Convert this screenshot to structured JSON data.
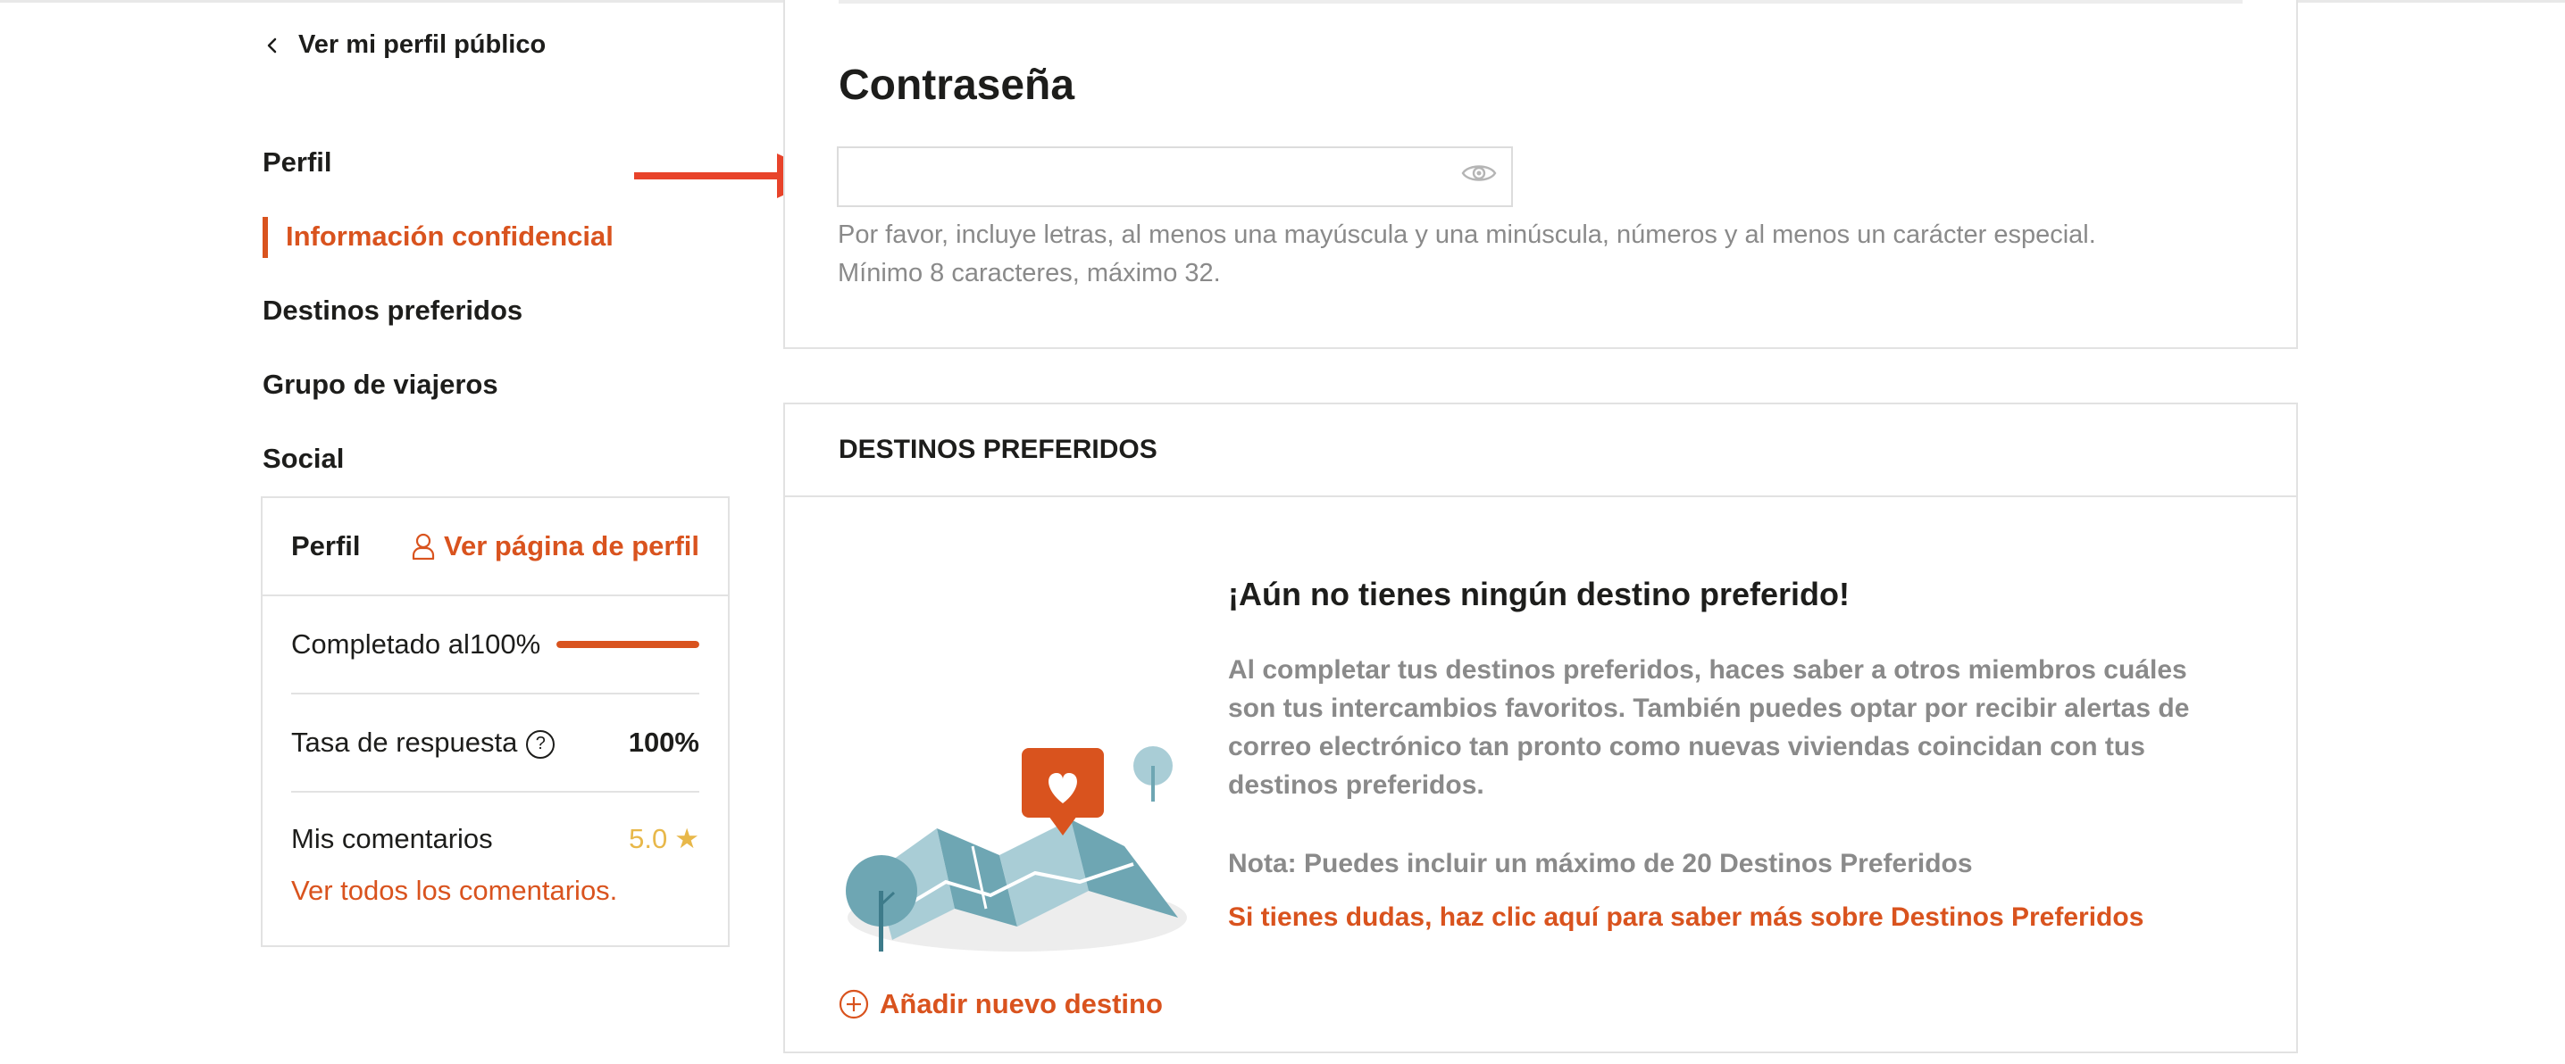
{
  "sidebar": {
    "back_link": "Ver mi perfil público",
    "items": [
      {
        "label": "Perfil",
        "active": false
      },
      {
        "label": "Información confidencial",
        "active": true
      },
      {
        "label": "Destinos preferidos",
        "active": false
      },
      {
        "label": "Grupo de viajeros",
        "active": false
      },
      {
        "label": "Social",
        "active": false
      }
    ]
  },
  "profile_card": {
    "title": "Perfil",
    "profile_link": "Ver página de perfil",
    "completed_label": "Completado al100%",
    "completed_progress": 1.0,
    "response_rate_label": "Tasa de respuesta",
    "help_icon_text": "?",
    "response_rate_value": "100%",
    "comments_label": "Mis comentarios",
    "rating_value": "5.0",
    "rating_star": "★",
    "all_comments_link": "Ver todos los comentarios."
  },
  "password": {
    "title": "Contraseña",
    "value": "",
    "hint_line1": "Por favor, incluye letras, al menos una mayúscula y una minúscula, números y al menos un carácter especial.",
    "hint_line2": "Mínimo 8 caracteres, máximo 32."
  },
  "destinations": {
    "section_title": "DESTINOS PREFERIDOS",
    "empty_title": "¡Aún no tienes ningún destino preferido!",
    "description": "Al completar tus destinos preferidos, haces saber a otros miembros cuáles son tus intercambios favoritos. También puedes optar por recibir alertas de correo electrónico tan pronto como nuevas viviendas coincidan con tus destinos preferidos.",
    "note": "Nota: Puedes incluir un máximo de 20 Destinos Preferidos",
    "help_link": "Si tienes dudas, haz clic aquí para saber más sobre Destinos Preferidos",
    "add_button": "Añadir nuevo destino"
  },
  "colors": {
    "accent": "#d9531e",
    "arrow": "#e8432a",
    "rating": "#e8b84a",
    "muted_text": "#8a8a8a",
    "border": "#e2e2e2",
    "map_teal": "#6ea6b3"
  },
  "icons": {
    "back": "chevron-left-icon",
    "profile": "user-icon",
    "eye": "eye-icon",
    "help": "question-circle-icon",
    "star": "star-icon",
    "add": "plus-circle-icon"
  }
}
